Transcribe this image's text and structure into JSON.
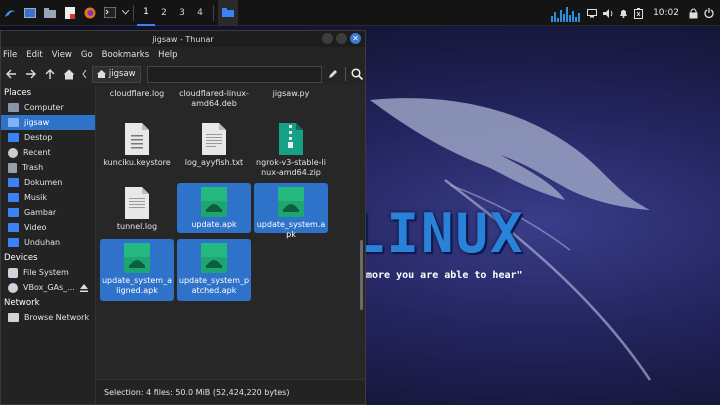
{
  "panel": {
    "workspaces": [
      "1",
      "2",
      "3",
      "4"
    ],
    "clock": "10:02"
  },
  "window": {
    "title": "jigsaw - Thunar",
    "close_glyph": "✕",
    "menu": [
      "File",
      "Edit",
      "View",
      "Go",
      "Bookmarks",
      "Help"
    ],
    "breadcrumb": "jigsaw",
    "path_value": ""
  },
  "sidebar": {
    "places_header": "Places",
    "places": [
      "Computer",
      "jigsaw",
      "Destop",
      "Recent",
      "Trash",
      "Dokumen",
      "Musik",
      "Gambar",
      "Video",
      "Unduhan"
    ],
    "devices_header": "Devices",
    "devices": [
      "File System",
      "VBox_GAs_..."
    ],
    "network_header": "Network",
    "network": [
      "Browse Network"
    ]
  },
  "files": [
    {
      "name": "cloudflare.log",
      "type": "none"
    },
    {
      "name": "cloudflared-linux-amd64.deb",
      "type": "none"
    },
    {
      "name": "jigsaw.py",
      "type": "none"
    },
    {
      "name": "kunciku.keystore",
      "type": "binary"
    },
    {
      "name": "log_ayyfish.txt",
      "type": "text"
    },
    {
      "name": "ngrok-v3-stable-linux-amd64.zip",
      "type": "zip"
    },
    {
      "name": "tunnel.log",
      "type": "text"
    },
    {
      "name": "update.apk",
      "type": "apk"
    },
    {
      "name": "update_system.apk",
      "type": "apk"
    },
    {
      "name": "update_system_aligned.apk",
      "type": "apk"
    },
    {
      "name": "update_system_patched.apk",
      "type": "apk"
    }
  ],
  "status": "Selection: 4 files: 50.0 MiB (52,424,220 bytes)",
  "wallpaper": {
    "logo_text": "LINUX",
    "quote": "more you are able to hear\""
  },
  "colors": {
    "accent": "#2f72c9",
    "apk_green": "#1ea672",
    "zip_teal": "#16a085"
  }
}
